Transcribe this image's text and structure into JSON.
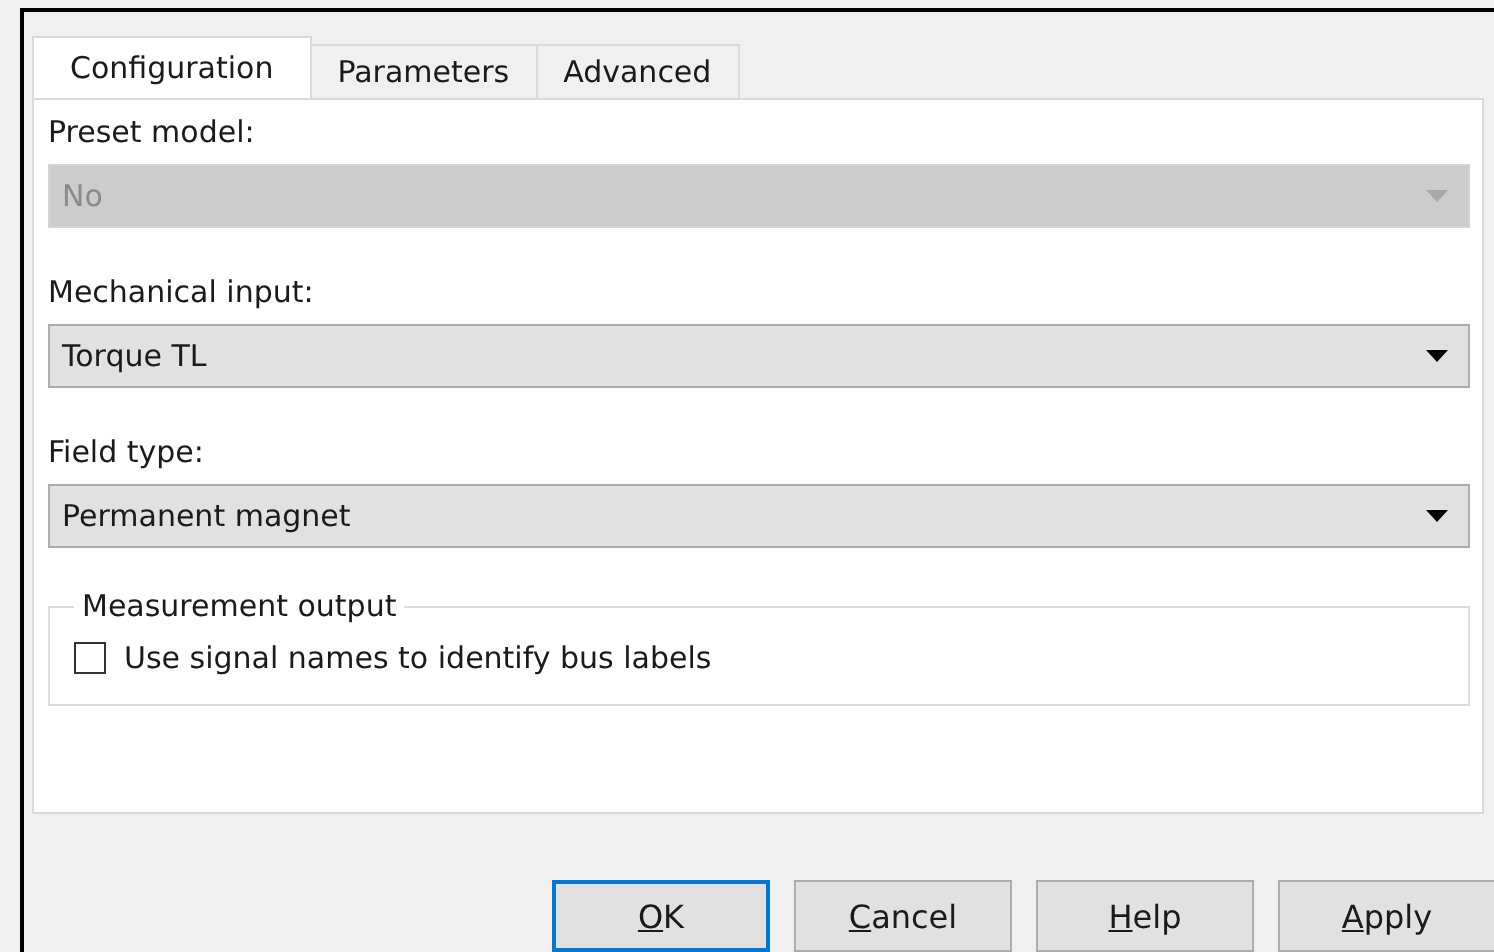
{
  "tabs": [
    {
      "label": "Configuration",
      "selected": true
    },
    {
      "label": "Parameters",
      "selected": false
    },
    {
      "label": "Advanced",
      "selected": false
    }
  ],
  "fields": [
    {
      "label": "Preset  model:",
      "value": "No",
      "disabled": true
    },
    {
      "label": "Mechanical input:",
      "value": "Torque TL",
      "disabled": false
    },
    {
      "label": "Field type:",
      "value": "Permanent magnet",
      "disabled": false
    }
  ],
  "group": {
    "title": "Measurement output",
    "checkbox": {
      "label": "Use signal names to identify bus labels",
      "checked": false
    }
  },
  "buttons": [
    {
      "label": "OK",
      "underline_first": true,
      "default": true
    },
    {
      "label": "Cancel",
      "underline_first": true,
      "default": false
    },
    {
      "label": "Help",
      "underline_first": true,
      "default": false
    },
    {
      "label": "Apply",
      "underline_first": true,
      "default": false
    }
  ]
}
